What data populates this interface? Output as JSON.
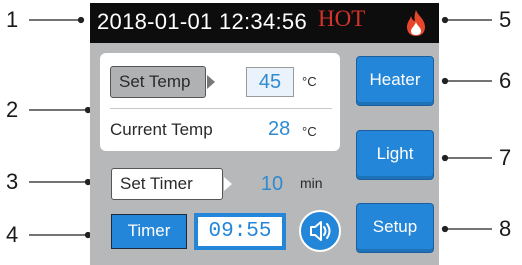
{
  "display": {
    "datetime": "2018-01-01 12:34:56",
    "hot_label": "HOT",
    "set_temp_label": "Set Temp",
    "set_temp_value": "45",
    "temp_unit": "°C",
    "current_temp_label": "Current Temp",
    "current_temp_value": "28",
    "set_timer_label": "Set Timer",
    "set_timer_value": "10",
    "timer_unit": "min",
    "timer_button_label": "Timer",
    "timer_clock": "09:55"
  },
  "buttons": {
    "heater": "Heater",
    "light": "Light",
    "setup": "Setup"
  },
  "callouts": [
    "1",
    "2",
    "3",
    "4",
    "5",
    "6",
    "7",
    "8"
  ],
  "icons": {
    "flame": "flame-icon",
    "speaker": "speaker-icon"
  },
  "colors": {
    "accent_blue": "#2386d9",
    "hot_red": "#d4322a",
    "panel_grey": "#b7b8ba",
    "topbar_black": "#0d0d0d"
  }
}
